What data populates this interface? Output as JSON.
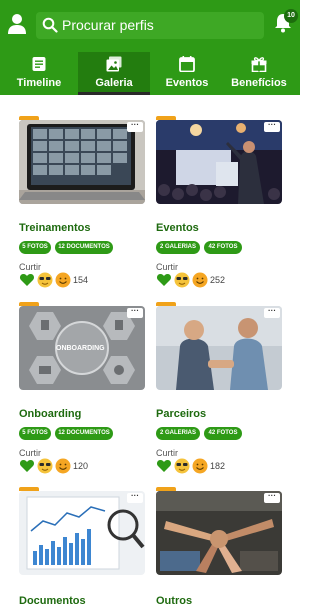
{
  "search": {
    "placeholder": "Procurar perfis"
  },
  "notifications": {
    "count": "10"
  },
  "tabs": [
    {
      "label": "Timeline",
      "icon": "document-icon"
    },
    {
      "label": "Galeria",
      "icon": "image-icon",
      "active": true
    },
    {
      "label": "Eventos",
      "icon": "calendar-icon"
    },
    {
      "label": "Benefícios",
      "icon": "gift-icon"
    }
  ],
  "cards": [
    {
      "title": "Treinamentos",
      "pills": [
        "5 FOTOS",
        "12 DOCUMENTOS"
      ],
      "like_label": "Curtir",
      "count": "154"
    },
    {
      "title": "Eventos",
      "pills": [
        "2 GALERIAS",
        "42 FOTOS"
      ],
      "like_label": "Curtir",
      "count": "252"
    },
    {
      "title": "Onboarding",
      "pills": [
        "5 FOTOS",
        "12 DOCUMENTOS"
      ],
      "like_label": "Curtir",
      "count": "120",
      "thumb_text": "ONBOARDING"
    },
    {
      "title": "Parceiros",
      "pills": [
        "2 GALERIAS",
        "42 FOTOS"
      ],
      "like_label": "Curtir",
      "count": "182"
    },
    {
      "title": "Documentos"
    },
    {
      "title": "Outros"
    }
  ],
  "colors": {
    "brand": "#2e9a16",
    "brand_dark": "#237d0f",
    "title": "#1e6a0f",
    "accent": "#f0a21a"
  }
}
